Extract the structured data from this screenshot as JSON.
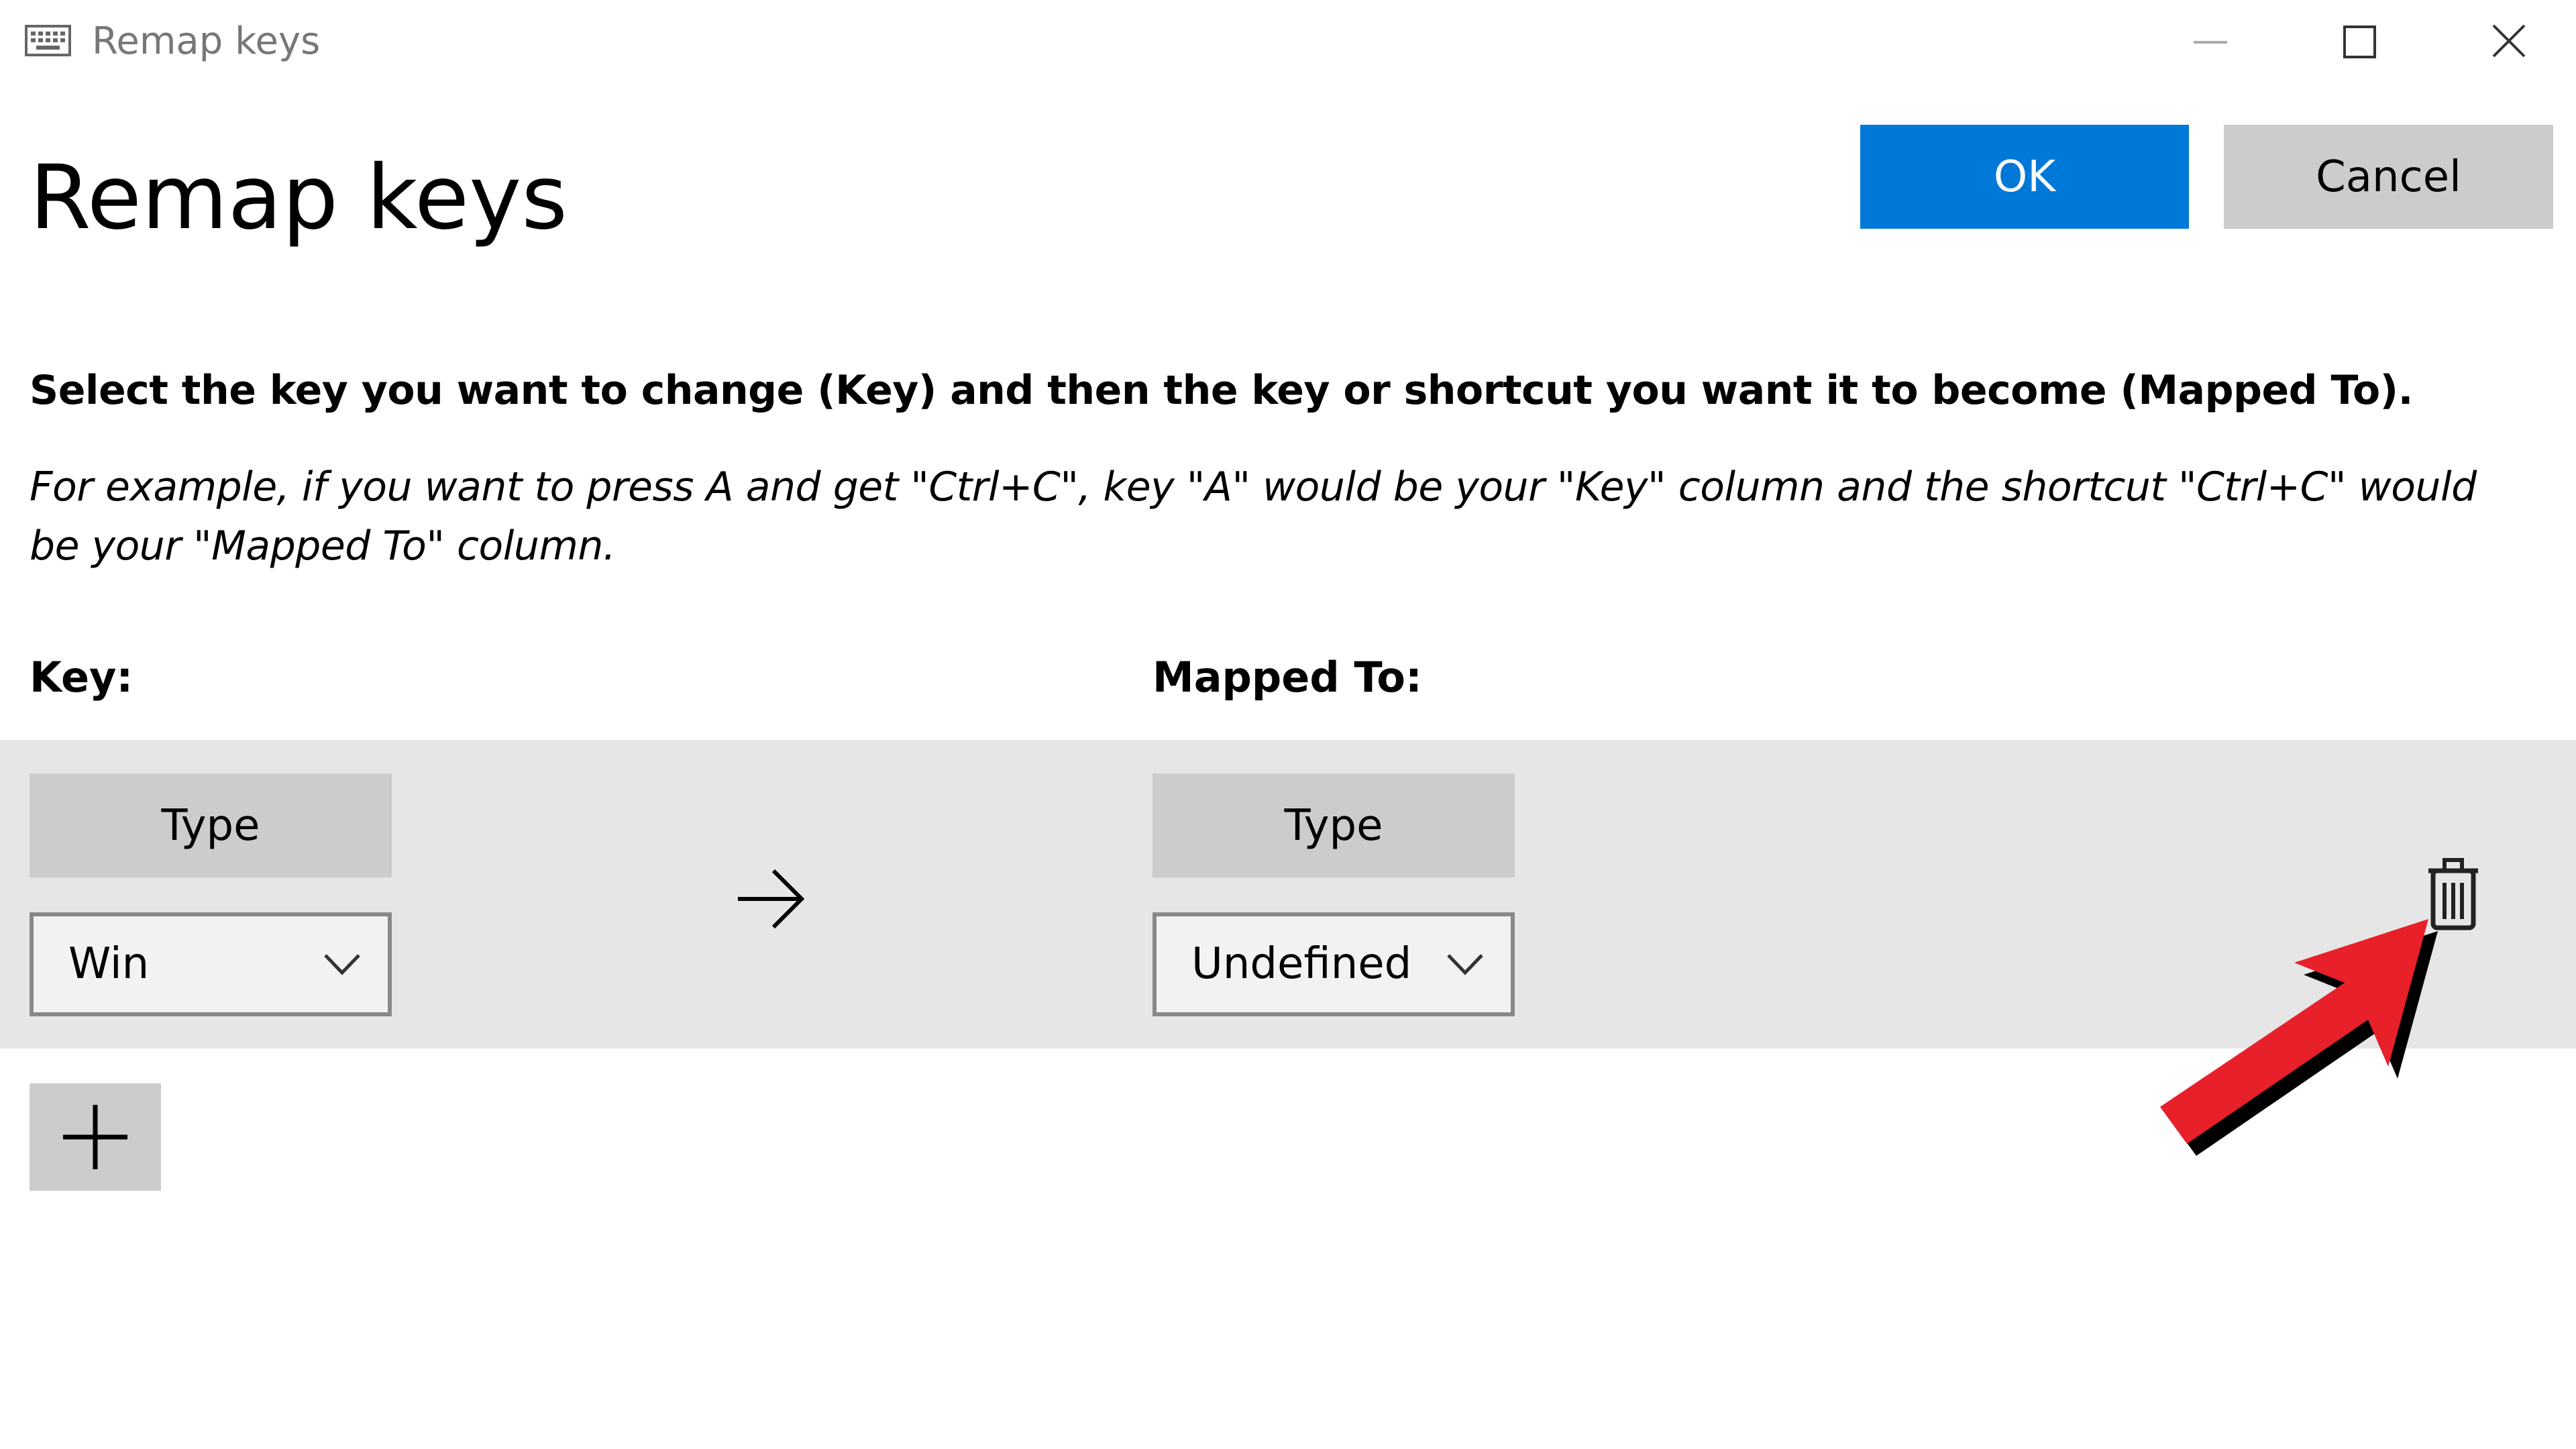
{
  "window": {
    "title": "Remap keys",
    "icon": "keyboard-icon",
    "controls": [
      "minimize-icon",
      "maximize-icon",
      "close-icon"
    ]
  },
  "header": {
    "title": "Remap keys",
    "ok_label": "OK",
    "cancel_label": "Cancel"
  },
  "instructions": {
    "main": "Select the key you want to change (Key) and then the key or shortcut you want it to become (Mapped To).",
    "example": "For example, if you want to press A and get \"Ctrl+C\", key \"A\" would be your \"Key\" column and the shortcut \"Ctrl+C\" would be your \"Mapped To\" column."
  },
  "columns": {
    "key_header": "Key:",
    "mapped_header": "Mapped To:"
  },
  "mappings": [
    {
      "key": {
        "type_label": "Type",
        "value": "Win"
      },
      "mapped_to": {
        "type_label": "Type",
        "value": "Undefined"
      },
      "arrow_icon": "right-arrow-icon",
      "delete_icon": "trash-icon"
    }
  ],
  "add_button": {
    "icon": "plus-icon"
  },
  "annotation": {
    "icon": "red-pointer-arrow",
    "color": "#e8202a"
  },
  "colors": {
    "accent": "#0078d7",
    "button_gray": "#cccccc",
    "row_background": "#e6e6e6",
    "title_gray": "#777777"
  }
}
